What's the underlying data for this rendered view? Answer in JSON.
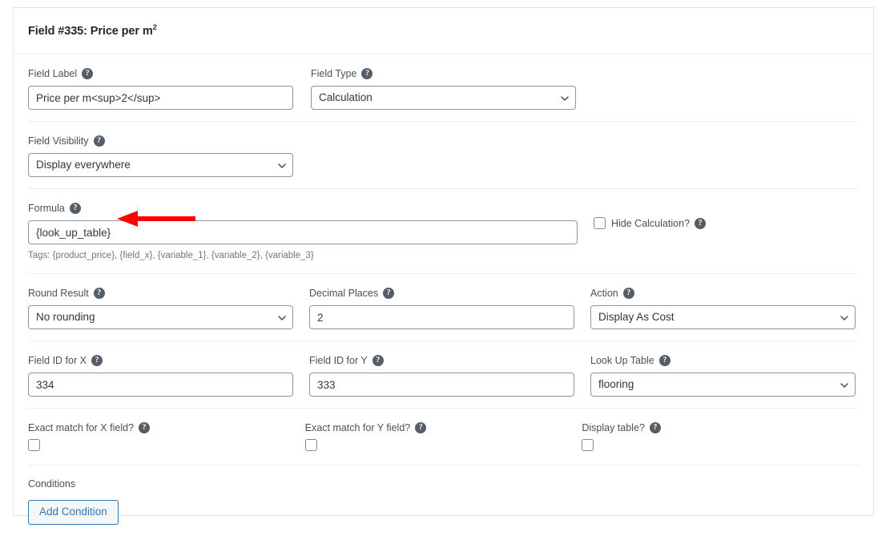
{
  "panel": {
    "title_prefix": "Field #335: Price per m",
    "title_sup": "2"
  },
  "help_glyph": "?",
  "fields": {
    "field_label": {
      "label": "Field Label",
      "value": "Price per m<sup>2</sup>",
      "placeholder": ""
    },
    "field_type": {
      "label": "Field Type",
      "value": "Calculation",
      "options": [
        "Calculation"
      ]
    },
    "field_visibility": {
      "label": "Field Visibility",
      "value": "Display everywhere",
      "options": [
        "Display everywhere"
      ]
    },
    "formula": {
      "label": "Formula",
      "value": "{look_up_table}",
      "placeholder": "",
      "tags": "Tags: {product_price}, {field_x}, {variable_1}, {variable_2}, {variable_3}"
    },
    "hide_calculation": {
      "label": "Hide Calculation?",
      "checked": false
    },
    "round_result": {
      "label": "Round Result",
      "value": "No rounding",
      "options": [
        "No rounding"
      ]
    },
    "decimal_places": {
      "label": "Decimal Places",
      "value": "2",
      "placeholder": ""
    },
    "action": {
      "label": "Action",
      "value": "Display As Cost",
      "options": [
        "Display As Cost"
      ]
    },
    "field_id_x": {
      "label": "Field ID for X",
      "value": "334",
      "placeholder": ""
    },
    "field_id_y": {
      "label": "Field ID for Y",
      "value": "333",
      "placeholder": ""
    },
    "look_up_table": {
      "label": "Look Up Table",
      "value": "flooring",
      "options": [
        "flooring"
      ]
    },
    "exact_match_x": {
      "label": "Exact match for X field?",
      "checked": false
    },
    "exact_match_y": {
      "label": "Exact match for Y field?",
      "checked": false
    },
    "display_table": {
      "label": "Display table?",
      "checked": false
    },
    "conditions": {
      "label": "Conditions",
      "add_button": "Add Condition"
    }
  },
  "colors": {
    "annotation_arrow": "#FF0000",
    "button_accent": "#2e76b4",
    "help_icon_bg": "#555d66"
  }
}
